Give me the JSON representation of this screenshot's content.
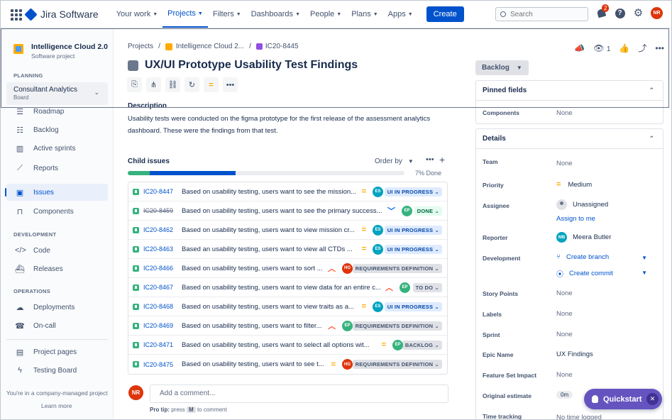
{
  "topnav": {
    "logo": "Jira Software",
    "items": [
      {
        "label": "Your work"
      },
      {
        "label": "Projects"
      },
      {
        "label": "Filters"
      },
      {
        "label": "Dashboards"
      },
      {
        "label": "People"
      },
      {
        "label": "Plans"
      },
      {
        "label": "Apps"
      }
    ],
    "active_item": "Projects",
    "create_label": "Create",
    "search_placeholder": "Search",
    "notification_count": "2",
    "user_initials": "NR"
  },
  "sidebar": {
    "project_name": "Intelligence Cloud 2.0",
    "project_type": "Software project",
    "planning_label": "PLANNING",
    "board_name": "Consultant Analytics",
    "board_type": "Board",
    "planning_items": [
      "Roadmap",
      "Backlog",
      "Active sprints",
      "Reports"
    ],
    "main_items": [
      "Issues",
      "Components"
    ],
    "active_item": "Issues",
    "development_label": "DEVELOPMENT",
    "development_items": [
      "Code",
      "Releases"
    ],
    "operations_label": "OPERATIONS",
    "operations_items": [
      "Deployments",
      "On-call"
    ],
    "footer_items": [
      "Project pages",
      "Testing Board"
    ],
    "managed_note": "You're in a company-managed project",
    "learn_more": "Learn more"
  },
  "issue": {
    "breadcrumbs": [
      "Projects",
      "Intelligence Cloud 2...",
      "IC20-8445"
    ],
    "title": "UX/UI Prototype Usability Test Findings",
    "description_label": "Description",
    "description": "Usability tests were conducted on the figma prototype for the first release of the assessment analytics dashboard. These were the findings from that test.",
    "child_issues_label": "Child issues",
    "order_by_label": "Order by",
    "progress_done_fraction": 0.08,
    "progress_inprogress_fraction": 0.31,
    "progress_label": "7% Done",
    "children": [
      {
        "key": "IC20-8447",
        "summary": "Based on usability testing, users want to see the mission...",
        "priority": "medium",
        "assignee": "ES",
        "status": "UI IN PROGRESS",
        "status_kind": "ip",
        "done": false
      },
      {
        "key": "IC20-8459",
        "summary": "Based on usability testing, users want to see the primary success...",
        "priority": "low",
        "assignee": "EP",
        "status": "DONE",
        "status_kind": "done",
        "done": true
      },
      {
        "key": "IC20-8462",
        "summary": "Based on usability testing, users want to view mission cr...",
        "priority": "medium",
        "assignee": "ES",
        "status": "UI IN PROGRESS",
        "status_kind": "ip",
        "done": false
      },
      {
        "key": "IC20-8463",
        "summary": "Based an usability testing, users want to view all CTDs ...",
        "priority": "medium",
        "assignee": "ES",
        "status": "UI IN PROGRESS",
        "status_kind": "ip",
        "done": false
      },
      {
        "key": "IC20-8466",
        "summary": "Based on usability testing, users want to sort ...",
        "priority": "high",
        "assignee": "HG",
        "status": "REQUIREMENTS DEFINITION",
        "status_kind": "req",
        "done": false
      },
      {
        "key": "IC20-8467",
        "summary": "Based on usability testing, users want to view data for an entire c...",
        "priority": "high",
        "assignee": "EP",
        "status": "TO DO",
        "status_kind": "req",
        "done": false
      },
      {
        "key": "IC20-8468",
        "summary": "Based on usability testing, users want to view traits as a...",
        "priority": "medium",
        "assignee": "ES",
        "status": "UI IN PROGRESS",
        "status_kind": "ip",
        "done": false
      },
      {
        "key": "IC20-8469",
        "summary": "Based on usability testing, users want to filter...",
        "priority": "high",
        "assignee": "EP",
        "status": "REQUIREMENTS DEFINITION",
        "status_kind": "req",
        "done": false
      },
      {
        "key": "IC20-8471",
        "summary": "Based on usability testing, users want to select all options wit...",
        "priority": "medium",
        "assignee": "EP",
        "status": "BACKLOG",
        "status_kind": "req",
        "done": false
      },
      {
        "key": "IC20-8475",
        "summary": "Based on usability testing, users want to see t...",
        "priority": "medium",
        "assignee": "HG",
        "status": "REQUIREMENTS DEFINITION",
        "status_kind": "req",
        "done": false
      }
    ],
    "comment_avatar": "NR",
    "comment_placeholder": "Add a comment...",
    "tip_prefix": "Pro tip:",
    "tip_press": "press",
    "tip_key": "M",
    "tip_suffix": "to comment"
  },
  "right_panel": {
    "watch_count": "1",
    "status_button": "Backlog",
    "pinned_label": "Pinned fields",
    "pinned_fields": [
      {
        "label": "Components",
        "value": "None"
      }
    ],
    "details_label": "Details",
    "team": {
      "label": "Team",
      "value": "None"
    },
    "priority": {
      "label": "Priority",
      "value": "Medium"
    },
    "assignee": {
      "label": "Assignee",
      "value": "Unassigned",
      "assign_link": "Assign to me"
    },
    "reporter": {
      "label": "Reporter",
      "value": "Meera Butler",
      "initials": "MB"
    },
    "development": {
      "label": "Development",
      "branch": "Create branch",
      "commit": "Create commit"
    },
    "story_points": {
      "label": "Story Points",
      "value": "None"
    },
    "labels": {
      "label": "Labels",
      "value": "None"
    },
    "sprint": {
      "label": "Sprint",
      "value": "None"
    },
    "epic_name": {
      "label": "Epic Name",
      "value": "UX Findings"
    },
    "feature_set": {
      "label": "Feature Set Impact",
      "value": "None"
    },
    "original_estimate": {
      "label": "Original estimate",
      "value": "0m"
    },
    "time_tracking": {
      "label": "Time tracking",
      "value": "No time logged"
    }
  },
  "quickstart": {
    "label": "Quickstart"
  }
}
